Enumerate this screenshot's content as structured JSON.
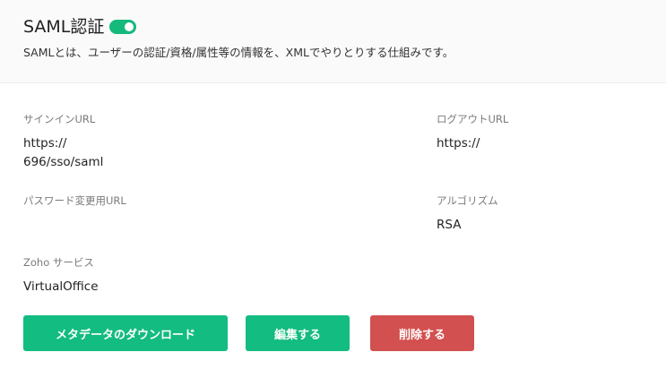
{
  "header": {
    "title": "SAML認証",
    "toggle_on": true,
    "description": "SAMLとは、ユーザーの認証/資格/属性等の情報を、XMLでやりとりする仕組みです。"
  },
  "fields": {
    "signin": {
      "label": "サインインURL",
      "value_line1": "https://",
      "value_line2": "696/sso/saml"
    },
    "logout": {
      "label": "ログアウトURL",
      "value": "https://"
    },
    "password_change": {
      "label": "パスワード変更用URL",
      "value": ""
    },
    "algorithm": {
      "label": "アルゴリズム",
      "value": "RSA"
    },
    "zoho_service": {
      "label": "Zoho サービス",
      "value": "VirtualOffice"
    }
  },
  "buttons": {
    "download_metadata": "メタデータのダウンロード",
    "edit": "編集する",
    "delete": "削除する"
  },
  "colors": {
    "accent_green": "#13bc80",
    "delete_red": "#d35050"
  }
}
